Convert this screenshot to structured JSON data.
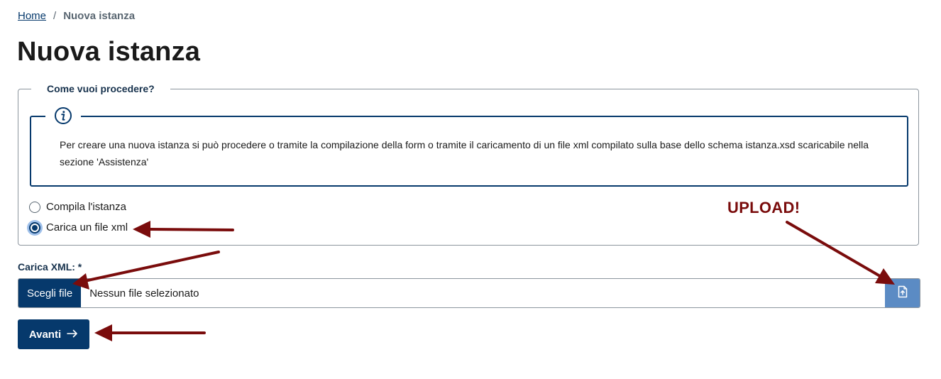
{
  "breadcrumb": {
    "home": "Home",
    "separator": "/",
    "current": "Nuova istanza"
  },
  "page_title": "Nuova istanza",
  "fieldset": {
    "legend": "Come vuoi procedere?",
    "info_icon": "info-circle-icon",
    "info_text": "Per creare una nuova istanza si può procedere o tramite la compilazione della form o tramite il caricamento di un file xml compilato sulla base dello schema istanza.xsd scaricabile nella sezione 'Assistenza'",
    "options": [
      {
        "label": "Compila l'istanza",
        "checked": false
      },
      {
        "label": "Carica un file xml",
        "checked": true
      }
    ]
  },
  "upload": {
    "label": "Carica XML: *",
    "choose_button": "Scegli file",
    "file_name": "Nessun file selezionato",
    "upload_icon": "file-upload-icon"
  },
  "next_button": {
    "label": "Avanti",
    "icon": "arrow-right-icon"
  },
  "annotation": {
    "text": "UPLOAD!",
    "color": "#7a0c0c"
  },
  "colors": {
    "primary": "#06396c",
    "upload_button": "#5b8bc4",
    "annotation": "#7a0c0c"
  }
}
